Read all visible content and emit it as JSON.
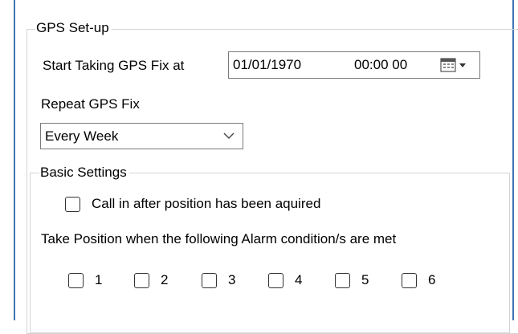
{
  "gps_setup": {
    "title": "GPS Set-up",
    "start_label": "Start Taking GPS Fix at",
    "start_date": "01/01/1970",
    "start_time": "00:00 00",
    "repeat_label": "Repeat GPS Fix",
    "repeat_value": "Every Week"
  },
  "basic_settings": {
    "title": "Basic Settings",
    "call_in_label": "Call in after position has been aquired",
    "call_in_checked": false,
    "alarm_label": "Take Position when the following Alarm condition/s are met",
    "alarm_options": [
      {
        "label": "1",
        "checked": false
      },
      {
        "label": "2",
        "checked": false
      },
      {
        "label": "3",
        "checked": false
      },
      {
        "label": "4",
        "checked": false
      },
      {
        "label": "5",
        "checked": false
      },
      {
        "label": "6",
        "checked": false
      }
    ]
  },
  "colors": {
    "frame_border": "#3f73b5",
    "group_border": "#d4d4d4"
  }
}
